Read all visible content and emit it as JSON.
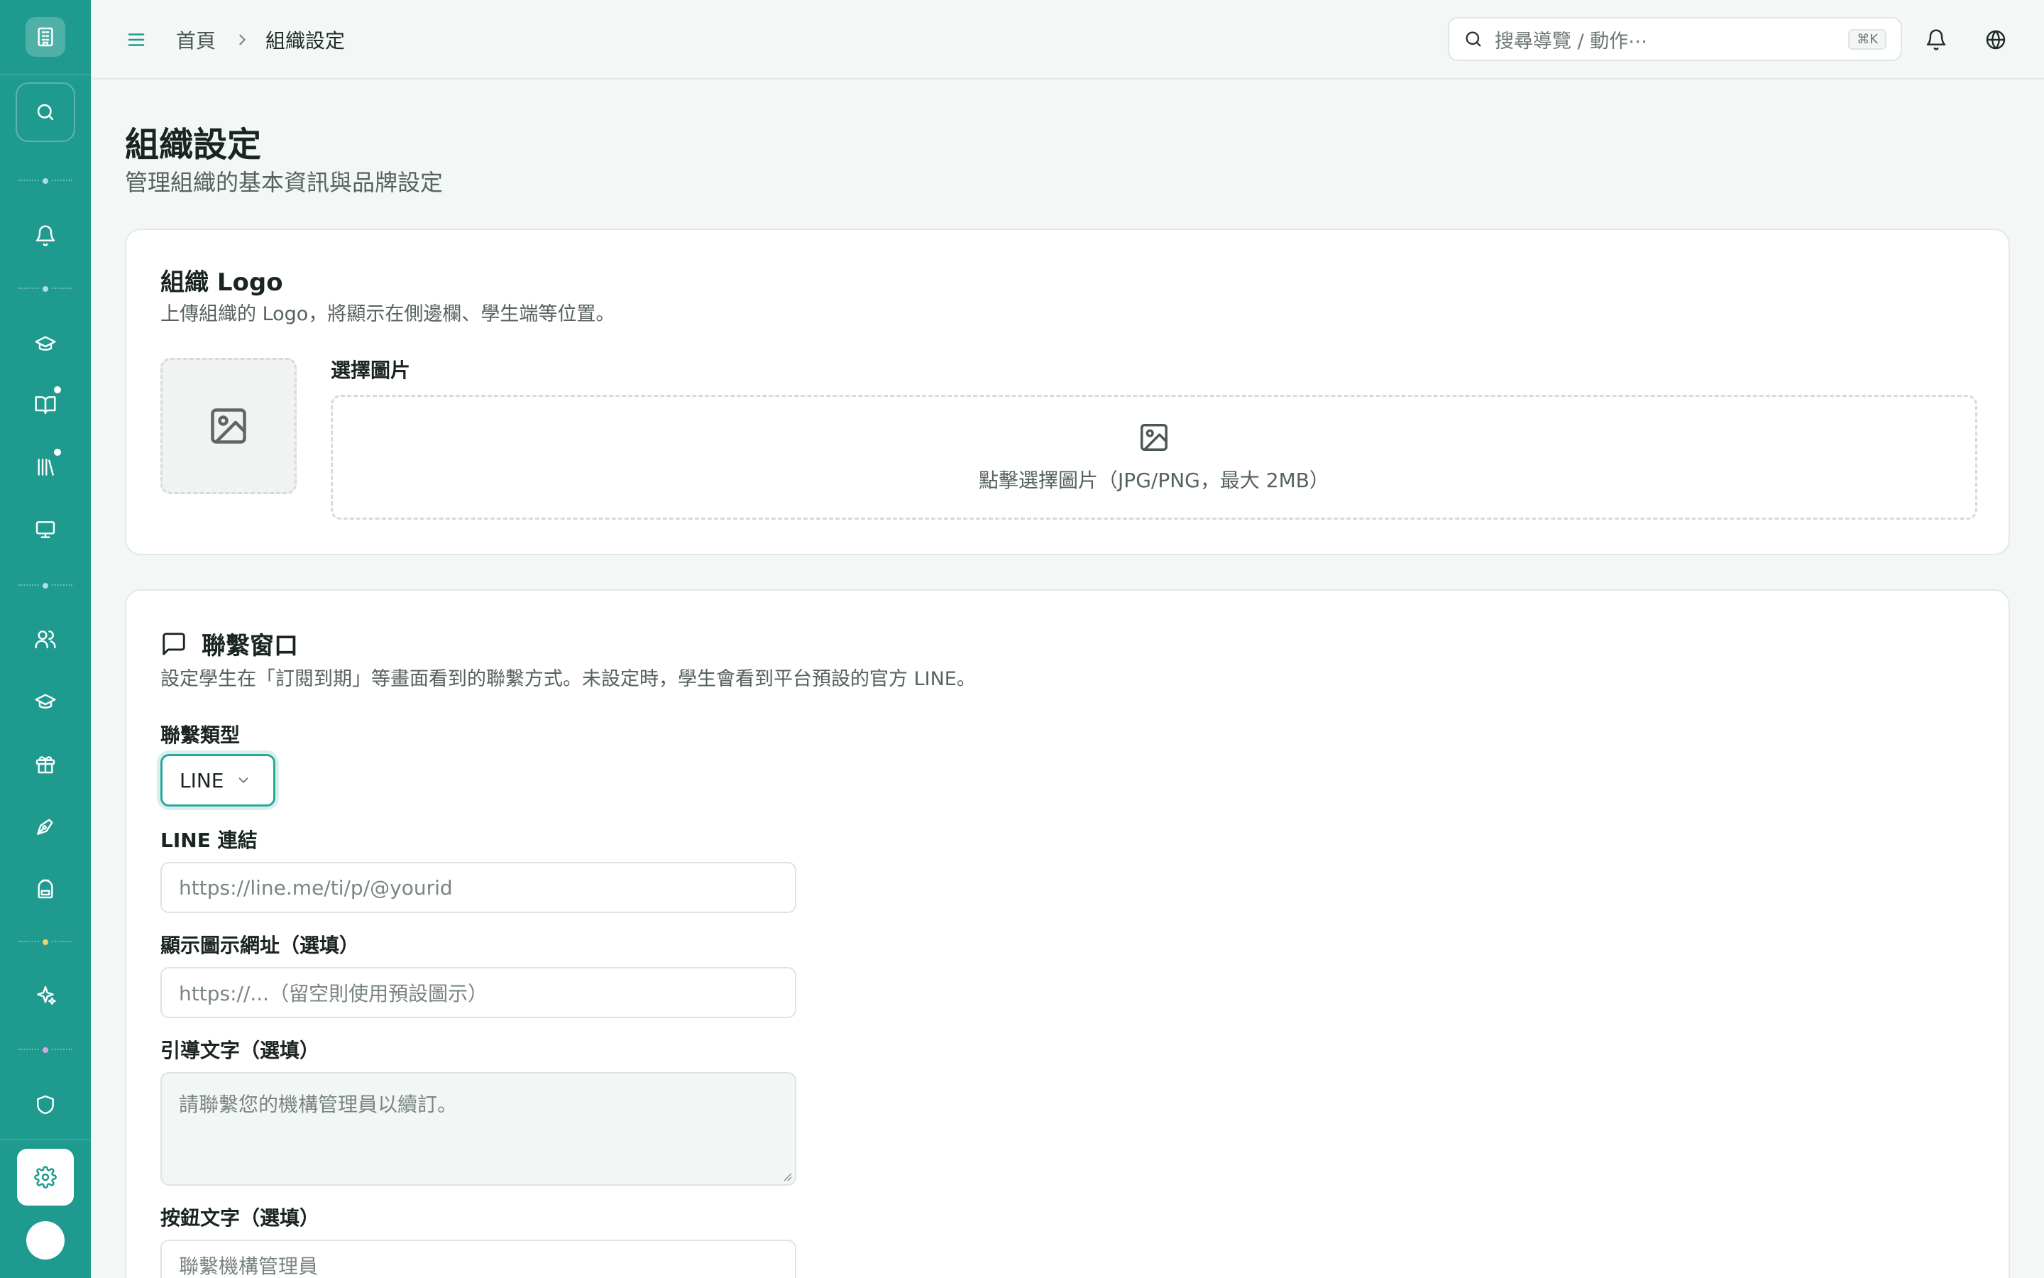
{
  "topbar": {
    "breadcrumb_home": "首頁",
    "breadcrumb_current": "組織設定",
    "search_placeholder": "搜尋導覽 / 動作⋯",
    "search_shortcut": "⌘K"
  },
  "page": {
    "title": "組織設定",
    "subtitle": "管理組織的基本資訊與品牌設定"
  },
  "logo_card": {
    "title": "組織 Logo",
    "description": "上傳組織的 Logo，將顯示在側邊欄、學生端等位置。",
    "choose_label": "選擇圖片",
    "dropzone_text": "點擊選擇圖片（JPG/PNG，最大 2MB）"
  },
  "contact_card": {
    "title": "聯繫窗口",
    "description": "設定學生在「訂閱到期」等畫面看到的聯繫方式。未設定時，學生會看到平台預設的官方 LINE。",
    "type_label": "聯繫類型",
    "type_value": "LINE",
    "link_label": "LINE 連結",
    "link_placeholder": "https://line.me/ti/p/@yourid",
    "icon_url_label": "顯示圖示網址（選填）",
    "icon_url_placeholder": "https://...（留空則使用預設圖示）",
    "guide_label": "引導文字（選填）",
    "guide_placeholder": "請聯繫您的機構管理員以續訂。",
    "button_label": "按鈕文字（選填）",
    "button_placeholder": "聯繫機構管理員"
  },
  "colors": {
    "sidebar": "#1f9a8f",
    "accent": "#2aa79b",
    "background": "#f3f7f6"
  },
  "icons": {
    "sidebar": [
      "building-icon",
      "search-icon",
      "bell-icon",
      "graduation-cap-icon",
      "book-open-icon",
      "library-icon",
      "monitor-icon",
      "users-icon",
      "graduation-cap-icon",
      "gift-icon",
      "pen-tool-icon",
      "backpack-icon",
      "sparkles-icon",
      "shield-icon",
      "gear-icon"
    ],
    "topbar": [
      "menu-icon",
      "chevron-right-icon",
      "search-icon",
      "bell-icon",
      "globe-icon"
    ]
  }
}
